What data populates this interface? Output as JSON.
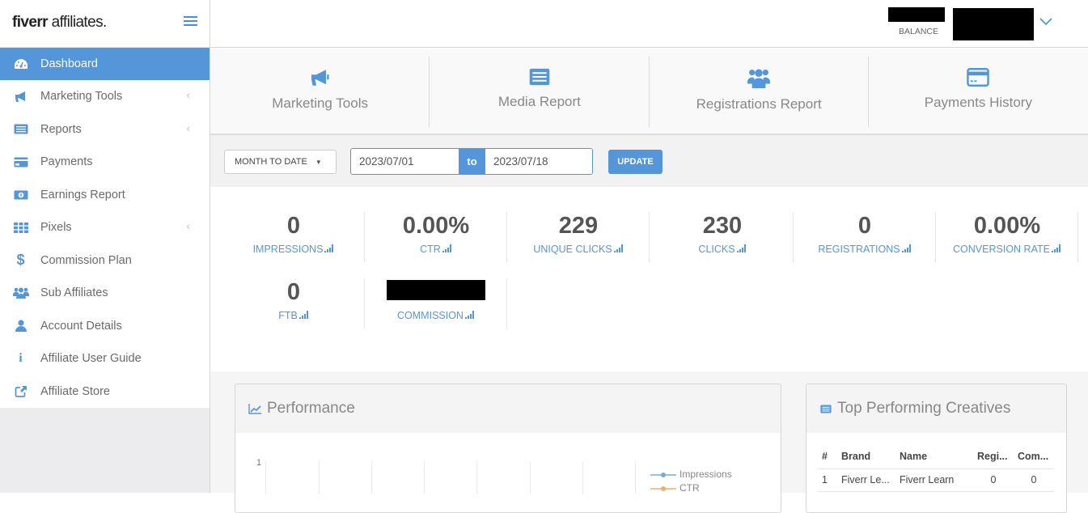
{
  "brand": {
    "logo_bold": "fiverr",
    "logo_rest": " affiliates."
  },
  "sidebar": {
    "items": [
      {
        "label": "Dashboard",
        "icon": "dashboard-icon",
        "active": true
      },
      {
        "label": "Marketing Tools",
        "icon": "bullhorn-icon",
        "has_chevron": true
      },
      {
        "label": "Reports",
        "icon": "list-icon",
        "has_chevron": true
      },
      {
        "label": "Payments",
        "icon": "credit-card-icon"
      },
      {
        "label": "Earnings Report",
        "icon": "money-icon"
      },
      {
        "label": "Pixels",
        "icon": "grid-icon",
        "has_chevron": true
      },
      {
        "label": "Commission Plan",
        "icon": "dollar-icon"
      },
      {
        "label": "Sub Affiliates",
        "icon": "users-icon"
      },
      {
        "label": "Account Details",
        "icon": "user-icon"
      },
      {
        "label": "Affiliate User Guide",
        "icon": "info-icon"
      },
      {
        "label": "Affiliate Store",
        "icon": "external-link-icon"
      }
    ],
    "chevron_glyph": "‹"
  },
  "topbar": {
    "balance_label": "BALANCE"
  },
  "quicklinks": [
    {
      "label": "Marketing Tools",
      "icon": "bullhorn-icon"
    },
    {
      "label": "Media Report",
      "icon": "list-icon"
    },
    {
      "label": "Registrations Report",
      "icon": "users-icon"
    },
    {
      "label": "Payments History",
      "icon": "credit-card-icon"
    }
  ],
  "filters": {
    "range_label": "MONTH TO DATE",
    "date_from": "2023/07/01",
    "to_label": "to",
    "date_to": "2023/07/18",
    "update_label": "UPDATE"
  },
  "stats": [
    {
      "value": "0",
      "label": "IMPRESSIONS"
    },
    {
      "value": "0.00%",
      "label": "CTR"
    },
    {
      "value": "229",
      "label": "UNIQUE CLICKS"
    },
    {
      "value": "230",
      "label": "CLICKS"
    },
    {
      "value": "0",
      "label": "REGISTRATIONS"
    },
    {
      "value": "0.00%",
      "label": "CONVERSION RATE"
    },
    {
      "value": "0",
      "label": "FTB"
    },
    {
      "value": "",
      "label": "COMMISSION",
      "redacted": true
    }
  ],
  "performance": {
    "title": "Performance",
    "y_tick": "1",
    "legend": [
      {
        "name": "Impressions",
        "color": "#9ec0de"
      },
      {
        "name": "CTR",
        "color": "#f5c18e"
      }
    ]
  },
  "creatives": {
    "title": "Top Performing Creatives",
    "columns": [
      "#",
      "Brand",
      "Name",
      "Regi...",
      "Com..."
    ],
    "rows": [
      [
        "1",
        "Fiverr Le...",
        "Fiverr Learn",
        "0",
        "0"
      ]
    ]
  },
  "colors": {
    "accent": "#5596db"
  }
}
